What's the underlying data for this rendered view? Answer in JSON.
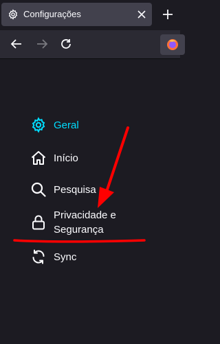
{
  "tab": {
    "title": "Configurações",
    "icon": "gear-icon"
  },
  "navbar": {
    "back": "back-arrow-icon",
    "forward": "forward-arrow-icon",
    "reload": "reload-icon",
    "extension": "firefox-icon"
  },
  "sidebar": {
    "items": [
      {
        "label": "Geral",
        "icon": "gear-icon",
        "selected": true
      },
      {
        "label": "Início",
        "icon": "home-icon"
      },
      {
        "label": "Pesquisa",
        "icon": "search-icon"
      },
      {
        "label": "Privacidade e",
        "label2": "Segurança",
        "icon": "lock-icon"
      },
      {
        "label": "Sync",
        "icon": "sync-icon"
      }
    ]
  },
  "colors": {
    "accent": "#00ddff",
    "annotation": "#ff0000",
    "background": "#1c1b22"
  }
}
